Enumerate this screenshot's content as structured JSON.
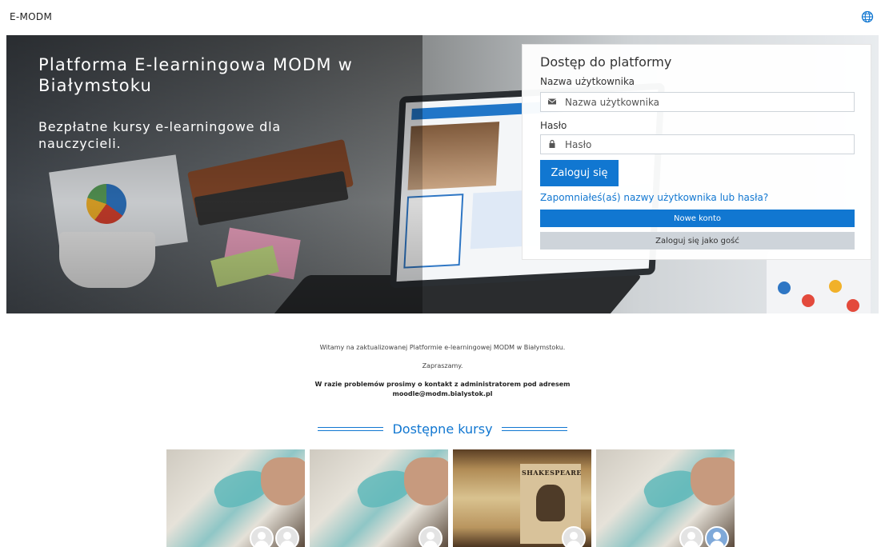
{
  "header": {
    "brand": "E-MODM",
    "language_icon": "globe-icon"
  },
  "hero": {
    "title": "Platforma E-learningowa MODM w Białymstoku",
    "subtitle": "Bezpłatne kursy e-learningowe dla nauczycieli."
  },
  "login": {
    "heading": "Dostęp do platformy",
    "username_label": "Nazwa użytkownika",
    "username_placeholder": "Nazwa użytkownika",
    "username_icon": "envelope-icon",
    "password_label": "Hasło",
    "password_placeholder": "Hasło",
    "password_icon": "lock-icon",
    "login_button": "Zaloguj się",
    "forgot_link": "Zapomniałeś(aś) nazwy użytkownika lub hasła?",
    "new_account_button": "Nowe konto",
    "guest_button": "Zaloguj się jako gość",
    "accent_color": "#1177d1"
  },
  "intro": {
    "line1": "Witamy na zaktualizowanej Platformie e-learningowej MODM w Białymstoku.",
    "line2": "Zapraszamy.",
    "line3": "W razie problemów prosimy o kontakt z administratorem pod adresem",
    "email": "moodle@modm.bialystok.pl"
  },
  "courses": {
    "heading": "Dostępne kursy",
    "cards": [
      {
        "image": "watercolor-painting",
        "avatars": 2
      },
      {
        "image": "watercolor-painting",
        "avatars": 1
      },
      {
        "image": "shakespeare-book",
        "book_title": "SHAKESPEARE",
        "avatars": 1
      },
      {
        "image": "watercolor-painting",
        "avatars": 2
      }
    ]
  }
}
